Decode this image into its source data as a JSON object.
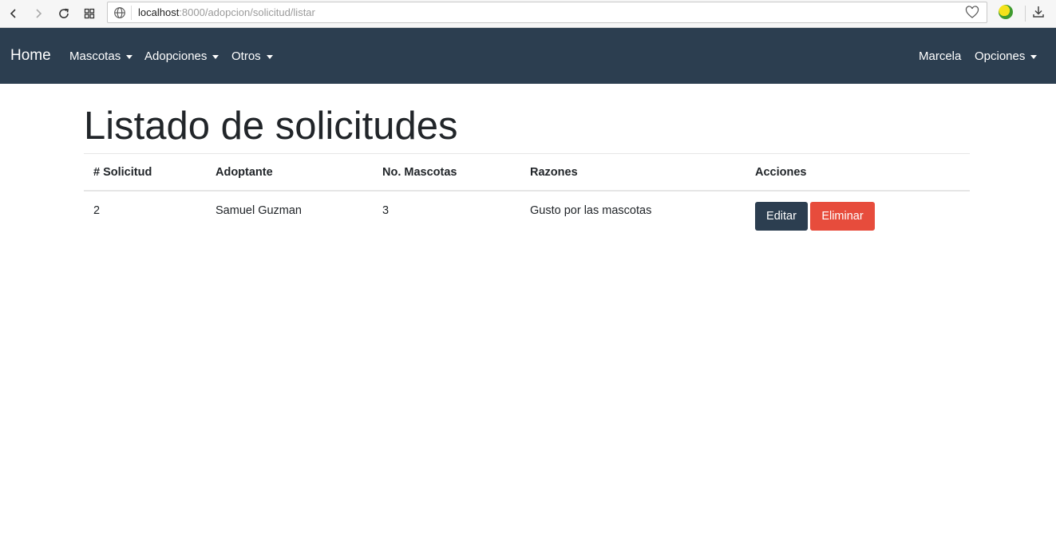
{
  "browser": {
    "url_host": "localhost",
    "url_rest": ":8000/adopcion/solicitud/listar"
  },
  "navbar": {
    "brand": "Home",
    "menus": [
      {
        "label": "Mascotas"
      },
      {
        "label": "Adopciones"
      },
      {
        "label": "Otros"
      }
    ],
    "user": "Marcela",
    "options": "Opciones",
    "background": "#2c3e50"
  },
  "page": {
    "title": "Listado de solicitudes"
  },
  "table": {
    "headers": [
      "# Solicitud",
      "Adoptante",
      "No. Mascotas",
      "Razones",
      "Acciones"
    ],
    "rows": [
      {
        "id": "2",
        "adoptante": "Samuel Guzman",
        "mascotas": "3",
        "razones": "Gusto por las mascotas",
        "edit_label": "Editar",
        "delete_label": "Eliminar"
      }
    ]
  },
  "colors": {
    "primary": "#2c3e50",
    "danger": "#e74c3c"
  }
}
